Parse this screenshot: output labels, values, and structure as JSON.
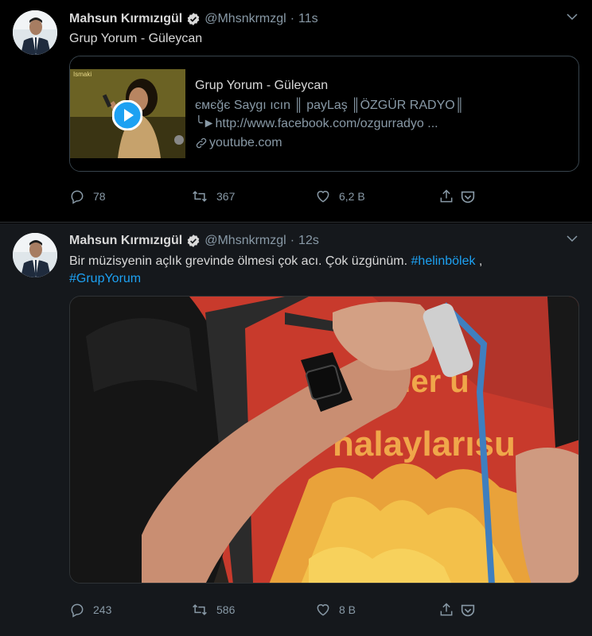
{
  "tweets": [
    {
      "name": "Mahsun Kırmızıgül",
      "handle": "@Mhsnkrmzgl",
      "dot": "·",
      "time": "11s",
      "text": "Grup Yorum - Güleycan",
      "card": {
        "title": "Grup Yorum - Güleycan",
        "thumb_label": "Ismaki",
        "desc_line1": "ємєğє Saygı ıcın ║ payLaş ║ÖZGÜR RADYO║",
        "desc_line2": "╰►http://www.facebook.com/ozgurradyo ...",
        "domain": "youtube.com"
      },
      "replies": "78",
      "retweets": "367",
      "likes": "6,2 B"
    },
    {
      "name": "Mahsun Kırmızıgül",
      "handle": "@Mhsnkrmzgl",
      "dot": "·",
      "time": "12s",
      "text_plain": "Bir müzisyenin açlık grevinde ölmesi çok acı.  Çok üzgünüm. ",
      "hashtag1": "#helinbölek",
      "separator": " ,",
      "hashtag2": "#GrupYorum",
      "media_text_line1": "ıller u",
      "media_text_line2": "halaylarısu",
      "replies": "243",
      "retweets": "586",
      "likes": "8 B"
    }
  ],
  "colors": {
    "background_top": "#000000",
    "background_bottom": "#15181c",
    "text": "#d9d9d9",
    "secondary": "#8899a6",
    "link": "#1da1f2",
    "border": "#38444d"
  }
}
